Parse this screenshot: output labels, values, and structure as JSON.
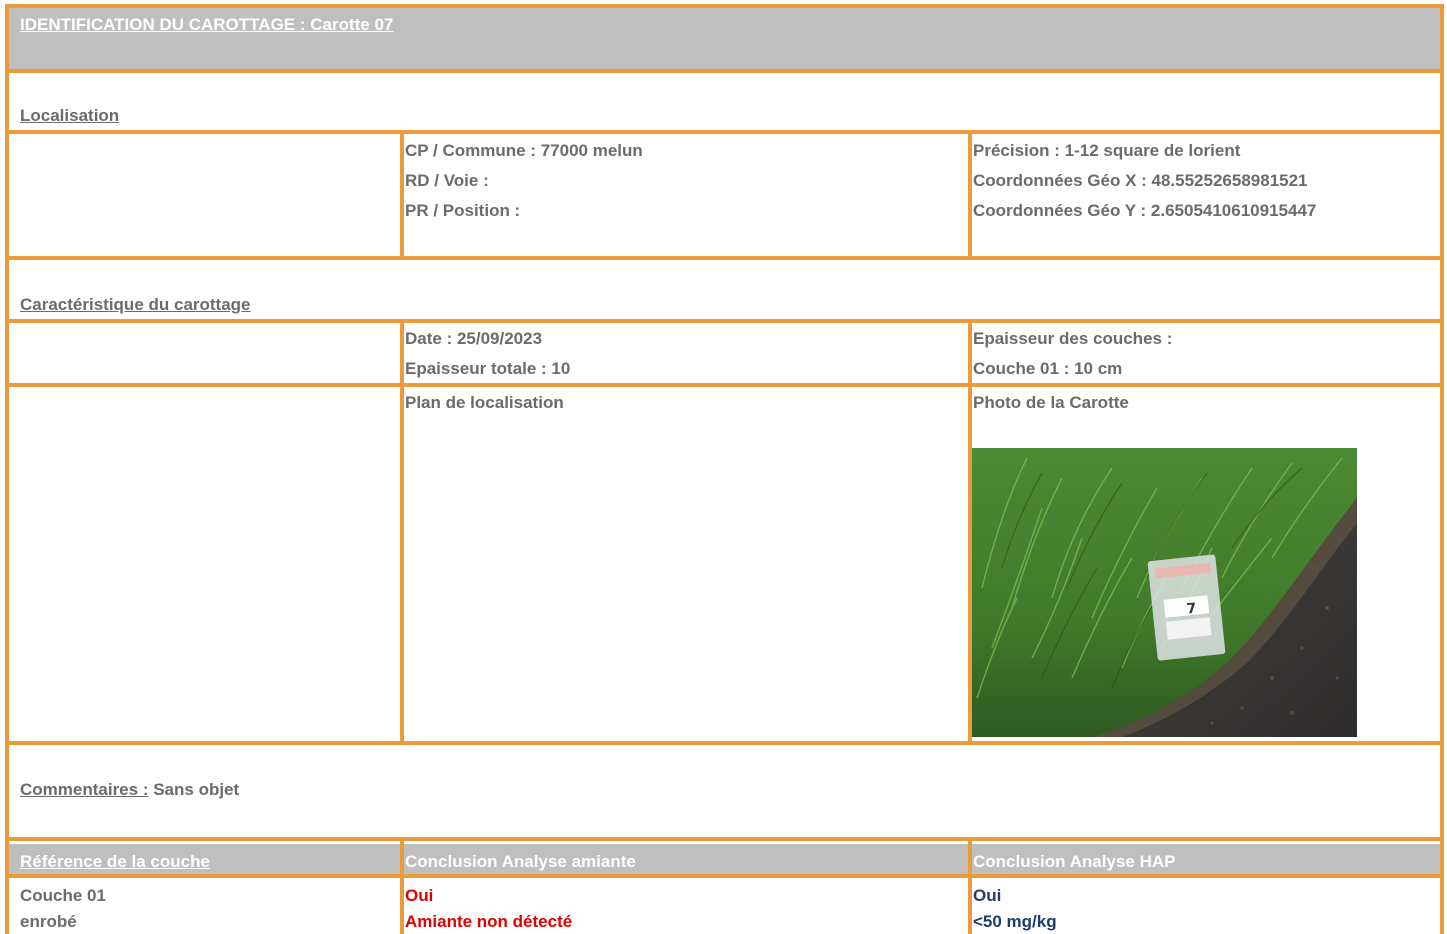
{
  "header": {
    "title": "IDENTIFICATION DU CAROTTAGE : Carotte 07"
  },
  "localisation": {
    "heading": "Localisation",
    "cp_commune": "CP / Commune : 77000 melun",
    "rd_voie": "RD / Voie :",
    "pr_position": "PR / Position :",
    "precision": "Précision :  1-12 square de lorient",
    "geo_x": "Coordonnées Géo X : 48.55252658981521",
    "geo_y": "Coordonnées Géo Y : 2.6505410610915447"
  },
  "caracteristique": {
    "heading": "Caractéristique du carottage",
    "date": "Date : 25/09/2023",
    "epaisseur_totale": "Epaisseur totale : 10",
    "epaisseur_couches": "Epaisseur des couches :",
    "couche_01": "Couche 01 : 10 cm",
    "plan_label": "Plan de localisation",
    "photo_label": "Photo de la Carotte"
  },
  "photo": {
    "bag_label": "7"
  },
  "commentaires": {
    "label": "Commentaires :",
    "value": " Sans objet"
  },
  "results": {
    "headers": [
      "Référence de la couche",
      "Conclusion Analyse amiante",
      "Conclusion Analyse HAP"
    ],
    "row": {
      "ref_line1": "Couche 01",
      "ref_line2": "enrobé",
      "amiante_line1": "Oui",
      "amiante_line2": "Amiante non détecté",
      "hap_line1": "Oui",
      "hap_line2": "<50 mg/kg"
    }
  },
  "colors": {
    "border": "#ec9a3a",
    "header_bg": "#bfbfbf",
    "red": "#e00000",
    "blue": "#1f3d6e",
    "text": "#6b6b6b"
  }
}
